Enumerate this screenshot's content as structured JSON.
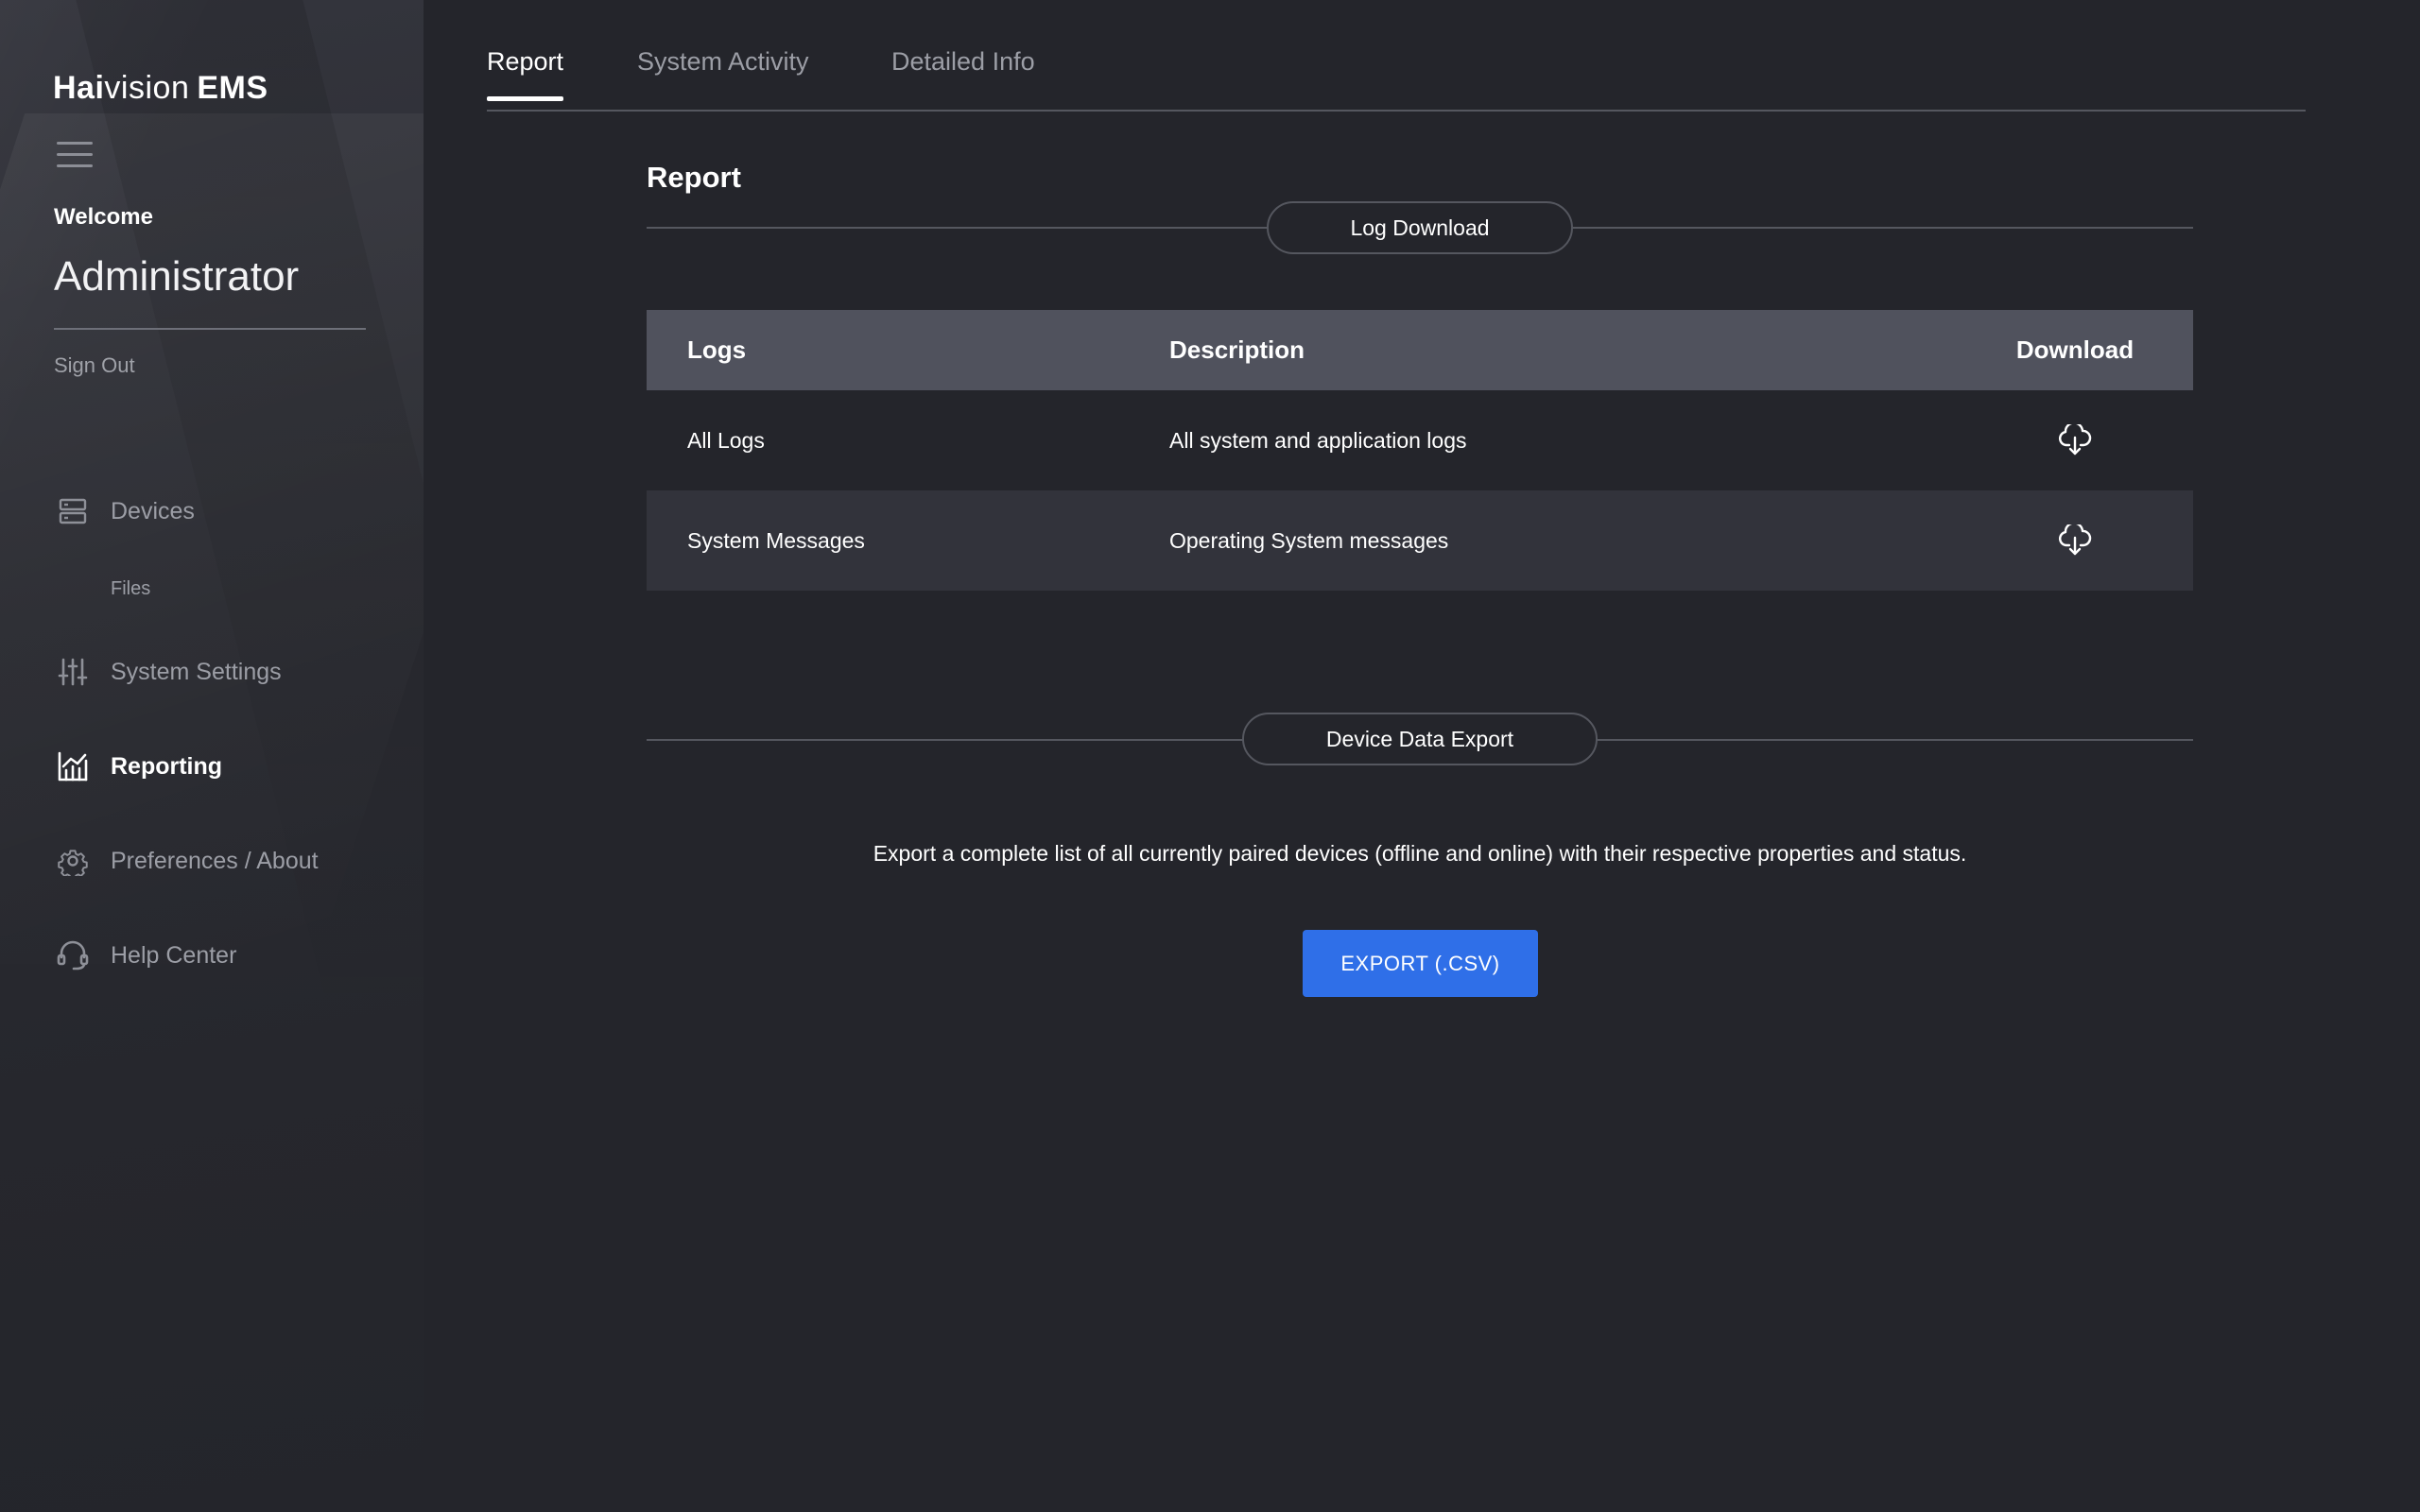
{
  "app": {
    "logo_hai": "Hai",
    "logo_vision": "vision",
    "logo_ems": "EMS"
  },
  "user": {
    "welcome": "Welcome",
    "name": "Administrator",
    "sign_out": "Sign Out"
  },
  "sidebar": {
    "items": [
      {
        "label": "Devices",
        "icon": "devices-icon"
      },
      {
        "label": "Files"
      },
      {
        "label": "System Settings",
        "icon": "sliders-icon"
      },
      {
        "label": "Reporting",
        "icon": "chart-icon",
        "active": true
      },
      {
        "label": "Preferences / About",
        "icon": "gear-icon"
      },
      {
        "label": "Help Center",
        "icon": "headset-icon"
      }
    ]
  },
  "tabs": [
    {
      "label": "Report",
      "active": true
    },
    {
      "label": "System Activity"
    },
    {
      "label": "Detailed Info"
    }
  ],
  "main": {
    "title": "Report",
    "log_section": "Log Download",
    "table": {
      "headers": [
        "Logs",
        "Description",
        "Download"
      ],
      "rows": [
        {
          "log": "All Logs",
          "description": "All system and application logs"
        },
        {
          "log": "System Messages",
          "description": "Operating System messages"
        }
      ]
    },
    "export_section": "Device Data Export",
    "export_text": "Export a complete list of all currently paired devices (offline and online) with their respective properties and status.",
    "export_button": "EXPORT (.CSV)"
  },
  "colors": {
    "background": "#24252b",
    "accent": "#2f6fe8",
    "table_header": "#50525d"
  }
}
